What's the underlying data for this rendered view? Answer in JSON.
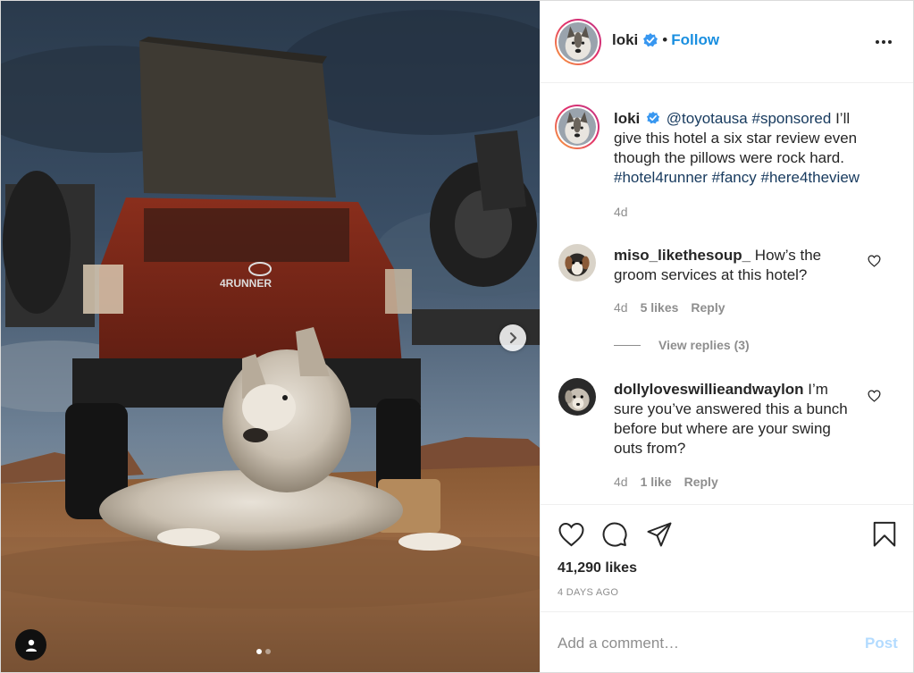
{
  "post": {
    "author": "loki",
    "follow_label": "Follow",
    "separator": "•",
    "caption": {
      "user": "loki",
      "mention": "@toyotausa",
      "tag_sponsored": "#sponsored",
      "text": "I’ll give this hotel a six star review even though the pillows were rock hard.",
      "tags": [
        "#hotel4runner",
        "#fancy",
        "#here4theview"
      ],
      "age": "4d"
    },
    "comments": [
      {
        "user": "miso_likethesoup_",
        "text": "How’s the groom services at this hotel?",
        "age": "4d",
        "likes": "5 likes",
        "reply": "Reply",
        "view_replies": "View replies (3)"
      },
      {
        "user": "dollyloveswillieandwaylon",
        "text": "I’m sure you’ve answered this a bunch before but where are your swing outs from?",
        "age": "4d",
        "likes": "1 like",
        "reply": "Reply"
      }
    ],
    "likes_count": "41,290 likes",
    "posted": "4 DAYS AGO",
    "comment_input": {
      "placeholder": "Add a comment…",
      "value": ""
    },
    "post_button": "Post",
    "carousel": {
      "total": 2,
      "active": 1
    },
    "icons": {
      "verified": "verified-badge-icon",
      "more": "more-options-icon",
      "like": "heart-icon",
      "comment": "comment-icon",
      "share": "paper-plane-icon",
      "save": "bookmark-icon",
      "next": "chevron-right-icon",
      "user_tags": "user-tag-icon"
    },
    "colors": {
      "link": "#173a5e",
      "follow": "#1a8fe0",
      "post_disabled": "#b3dbff",
      "verified": "#3897f0"
    }
  }
}
